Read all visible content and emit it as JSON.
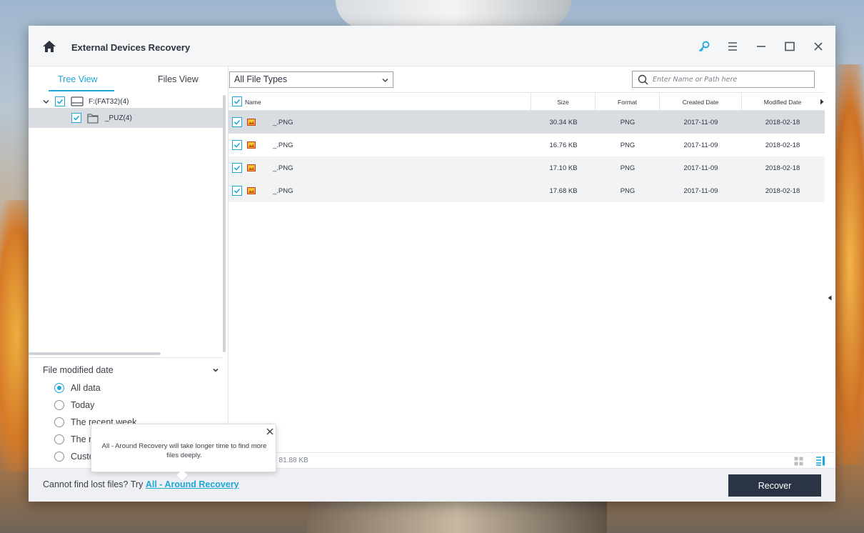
{
  "window": {
    "title": "External Devices Recovery",
    "accent_color": "#1ea6d6",
    "dark_button_color": "#2b3444"
  },
  "titlebar_icons": [
    "home-icon",
    "key-icon",
    "menu-icon",
    "minimize-icon",
    "maximize-icon",
    "close-icon"
  ],
  "left": {
    "tabs": [
      {
        "label": "Tree View",
        "active": true
      },
      {
        "label": "Files View",
        "active": false
      }
    ],
    "tree": [
      {
        "label": "F:(FAT32)(4)",
        "icon": "drive-icon",
        "checked": true,
        "expanded": true
      },
      {
        "label": "_PUZ(4)",
        "icon": "folder-icon",
        "checked": true,
        "selected": true
      }
    ],
    "filter": {
      "title": "File modified date",
      "options": [
        {
          "label": "All data",
          "checked": true
        },
        {
          "label": "Today",
          "checked": false
        },
        {
          "label": "The recent week",
          "checked": false
        },
        {
          "label": "The r",
          "checked": false
        },
        {
          "label": "Custo",
          "checked": false
        }
      ]
    }
  },
  "right": {
    "file_type": "All File Types",
    "search_placeholder": "Enter Name or Path here",
    "columns": {
      "name": "Name",
      "size": "Size",
      "format": "Format",
      "created": "Created Date",
      "modified": "Modified Date"
    },
    "rows": [
      {
        "name": "_.PNG",
        "size": "30.34 KB",
        "format": "PNG",
        "created": "2017-11-09",
        "modified": "2018-02-18"
      },
      {
        "name": "_.PNG",
        "size": "16.76 KB",
        "format": "PNG",
        "created": "2017-11-09",
        "modified": "2018-02-18"
      },
      {
        "name": "_.PNG",
        "size": "17.10 KB",
        "format": "PNG",
        "created": "2017-11-09",
        "modified": "2018-02-18"
      },
      {
        "name": "_.PNG",
        "size": "17.68 KB",
        "format": "PNG",
        "created": "2017-11-09",
        "modified": "2018-02-18"
      }
    ],
    "status": "s, 81.88 KB"
  },
  "footer": {
    "prompt": "Cannot find lost files? Try ",
    "link": "All - Around Recovery",
    "recover_label": "Recover"
  },
  "tooltip": {
    "text": "All - Around Recovery will take longer time to find more files deeply."
  }
}
